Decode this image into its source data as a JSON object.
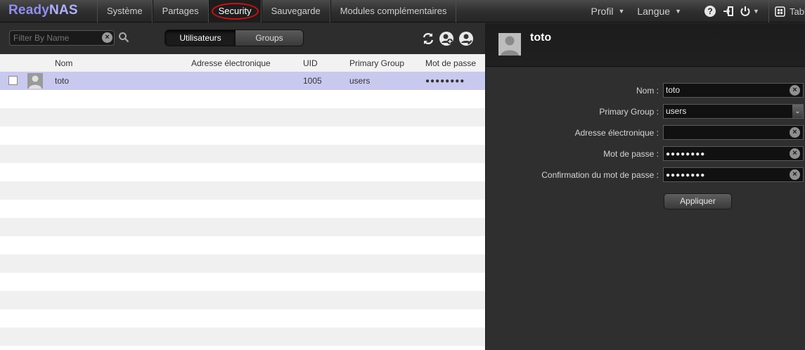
{
  "app": {
    "logo_a": "Ready",
    "logo_b": "NAS"
  },
  "nav": {
    "items": [
      {
        "label": "Système"
      },
      {
        "label": "Partages"
      },
      {
        "label": "Security"
      },
      {
        "label": "Sauvegarde"
      },
      {
        "label": "Modules complémentaires"
      }
    ],
    "active": "Security"
  },
  "right_nav": {
    "profil": "Profil",
    "langue": "Langue",
    "tab": "Tableau de bord"
  },
  "toolbar": {
    "filter_placeholder": "Filter By Name",
    "seg_users": "Utilisateurs",
    "seg_groups": "Groups"
  },
  "table": {
    "columns": [
      "Nom",
      "Adresse électronique",
      "UID",
      "Primary Group",
      "Mot de passe"
    ],
    "rows": [
      {
        "nom": "toto",
        "email": "",
        "uid": "1005",
        "group": "users",
        "password": "●●●●●●●●"
      }
    ]
  },
  "detail": {
    "title": "toto",
    "labels": {
      "nom": "Nom :",
      "group": "Primary Group :",
      "email": "Adresse électronique :",
      "password": "Mot de passe :",
      "confirm": "Confirmation du mot de passe :"
    },
    "values": {
      "nom": "toto",
      "group": "users",
      "email": "",
      "password": "●●●●●●●●",
      "confirm": "●●●●●●●●"
    },
    "apply_label": "Appliquer"
  },
  "colors": {
    "logo": "#8f8ff0",
    "highlight_ring": "#d01010",
    "selected_row": "#c9c9ef"
  }
}
